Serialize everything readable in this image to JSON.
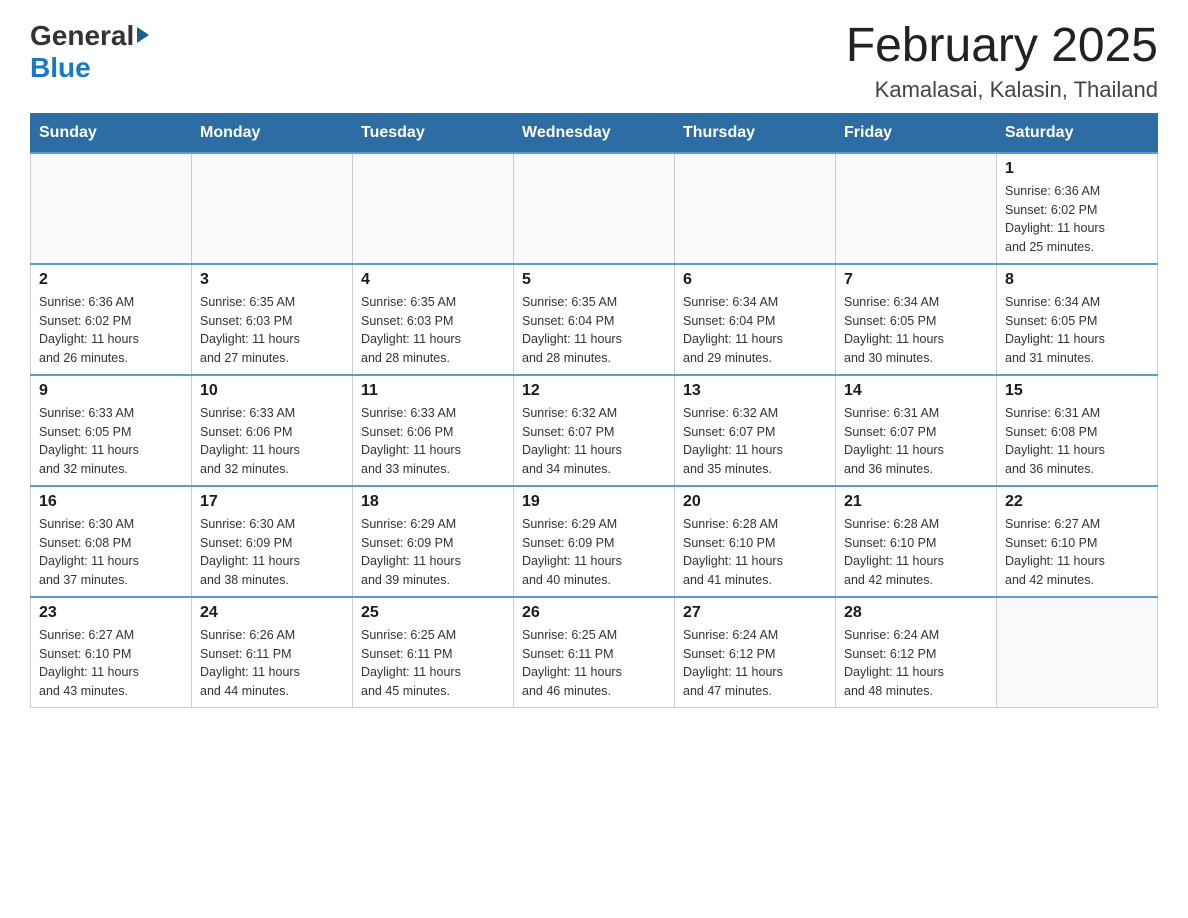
{
  "header": {
    "logo_general": "General",
    "logo_blue": "Blue",
    "title": "February 2025",
    "subtitle": "Kamalasai, Kalasin, Thailand"
  },
  "weekdays": [
    "Sunday",
    "Monday",
    "Tuesday",
    "Wednesday",
    "Thursday",
    "Friday",
    "Saturday"
  ],
  "weeks": [
    {
      "days": [
        {
          "number": "",
          "info": ""
        },
        {
          "number": "",
          "info": ""
        },
        {
          "number": "",
          "info": ""
        },
        {
          "number": "",
          "info": ""
        },
        {
          "number": "",
          "info": ""
        },
        {
          "number": "",
          "info": ""
        },
        {
          "number": "1",
          "info": "Sunrise: 6:36 AM\nSunset: 6:02 PM\nDaylight: 11 hours\nand 25 minutes."
        }
      ]
    },
    {
      "days": [
        {
          "number": "2",
          "info": "Sunrise: 6:36 AM\nSunset: 6:02 PM\nDaylight: 11 hours\nand 26 minutes."
        },
        {
          "number": "3",
          "info": "Sunrise: 6:35 AM\nSunset: 6:03 PM\nDaylight: 11 hours\nand 27 minutes."
        },
        {
          "number": "4",
          "info": "Sunrise: 6:35 AM\nSunset: 6:03 PM\nDaylight: 11 hours\nand 28 minutes."
        },
        {
          "number": "5",
          "info": "Sunrise: 6:35 AM\nSunset: 6:04 PM\nDaylight: 11 hours\nand 28 minutes."
        },
        {
          "number": "6",
          "info": "Sunrise: 6:34 AM\nSunset: 6:04 PM\nDaylight: 11 hours\nand 29 minutes."
        },
        {
          "number": "7",
          "info": "Sunrise: 6:34 AM\nSunset: 6:05 PM\nDaylight: 11 hours\nand 30 minutes."
        },
        {
          "number": "8",
          "info": "Sunrise: 6:34 AM\nSunset: 6:05 PM\nDaylight: 11 hours\nand 31 minutes."
        }
      ]
    },
    {
      "days": [
        {
          "number": "9",
          "info": "Sunrise: 6:33 AM\nSunset: 6:05 PM\nDaylight: 11 hours\nand 32 minutes."
        },
        {
          "number": "10",
          "info": "Sunrise: 6:33 AM\nSunset: 6:06 PM\nDaylight: 11 hours\nand 32 minutes."
        },
        {
          "number": "11",
          "info": "Sunrise: 6:33 AM\nSunset: 6:06 PM\nDaylight: 11 hours\nand 33 minutes."
        },
        {
          "number": "12",
          "info": "Sunrise: 6:32 AM\nSunset: 6:07 PM\nDaylight: 11 hours\nand 34 minutes."
        },
        {
          "number": "13",
          "info": "Sunrise: 6:32 AM\nSunset: 6:07 PM\nDaylight: 11 hours\nand 35 minutes."
        },
        {
          "number": "14",
          "info": "Sunrise: 6:31 AM\nSunset: 6:07 PM\nDaylight: 11 hours\nand 36 minutes."
        },
        {
          "number": "15",
          "info": "Sunrise: 6:31 AM\nSunset: 6:08 PM\nDaylight: 11 hours\nand 36 minutes."
        }
      ]
    },
    {
      "days": [
        {
          "number": "16",
          "info": "Sunrise: 6:30 AM\nSunset: 6:08 PM\nDaylight: 11 hours\nand 37 minutes."
        },
        {
          "number": "17",
          "info": "Sunrise: 6:30 AM\nSunset: 6:09 PM\nDaylight: 11 hours\nand 38 minutes."
        },
        {
          "number": "18",
          "info": "Sunrise: 6:29 AM\nSunset: 6:09 PM\nDaylight: 11 hours\nand 39 minutes."
        },
        {
          "number": "19",
          "info": "Sunrise: 6:29 AM\nSunset: 6:09 PM\nDaylight: 11 hours\nand 40 minutes."
        },
        {
          "number": "20",
          "info": "Sunrise: 6:28 AM\nSunset: 6:10 PM\nDaylight: 11 hours\nand 41 minutes."
        },
        {
          "number": "21",
          "info": "Sunrise: 6:28 AM\nSunset: 6:10 PM\nDaylight: 11 hours\nand 42 minutes."
        },
        {
          "number": "22",
          "info": "Sunrise: 6:27 AM\nSunset: 6:10 PM\nDaylight: 11 hours\nand 42 minutes."
        }
      ]
    },
    {
      "days": [
        {
          "number": "23",
          "info": "Sunrise: 6:27 AM\nSunset: 6:10 PM\nDaylight: 11 hours\nand 43 minutes."
        },
        {
          "number": "24",
          "info": "Sunrise: 6:26 AM\nSunset: 6:11 PM\nDaylight: 11 hours\nand 44 minutes."
        },
        {
          "number": "25",
          "info": "Sunrise: 6:25 AM\nSunset: 6:11 PM\nDaylight: 11 hours\nand 45 minutes."
        },
        {
          "number": "26",
          "info": "Sunrise: 6:25 AM\nSunset: 6:11 PM\nDaylight: 11 hours\nand 46 minutes."
        },
        {
          "number": "27",
          "info": "Sunrise: 6:24 AM\nSunset: 6:12 PM\nDaylight: 11 hours\nand 47 minutes."
        },
        {
          "number": "28",
          "info": "Sunrise: 6:24 AM\nSunset: 6:12 PM\nDaylight: 11 hours\nand 48 minutes."
        },
        {
          "number": "",
          "info": ""
        }
      ]
    }
  ]
}
